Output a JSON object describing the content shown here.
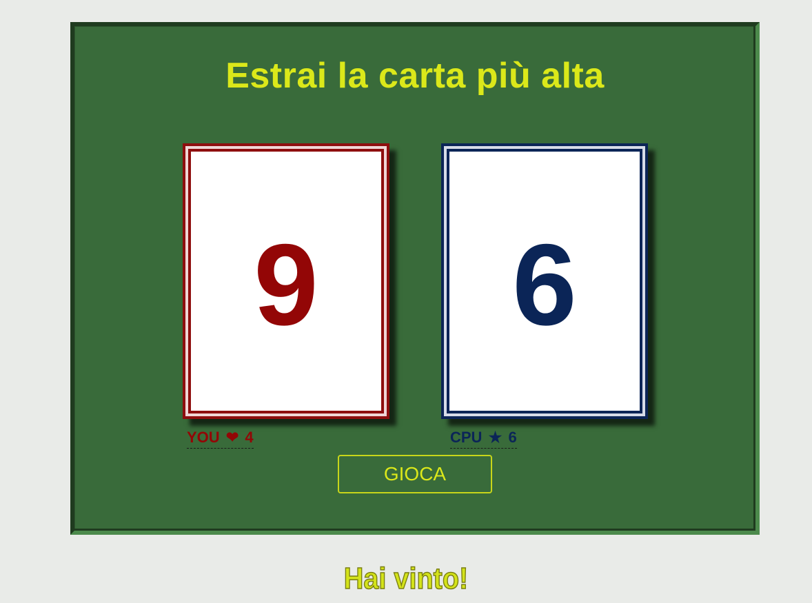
{
  "game": {
    "title": "Estrai la carta più alta",
    "player": {
      "card_value": "9",
      "label": "YOU",
      "symbol": "❤",
      "symbol_icon": "heart-icon",
      "score": "4",
      "color": "#930606"
    },
    "cpu": {
      "card_value": "6",
      "label": "CPU",
      "symbol": "★",
      "symbol_icon": "star-icon",
      "score": "6",
      "color": "#0b2557"
    },
    "play_button_label": "GIOCA",
    "result_message": "Hai vinto!"
  },
  "colors": {
    "page_background": "#e9ebe8",
    "table_green": "#396b3a",
    "accent_yellow": "#dbe81a"
  }
}
